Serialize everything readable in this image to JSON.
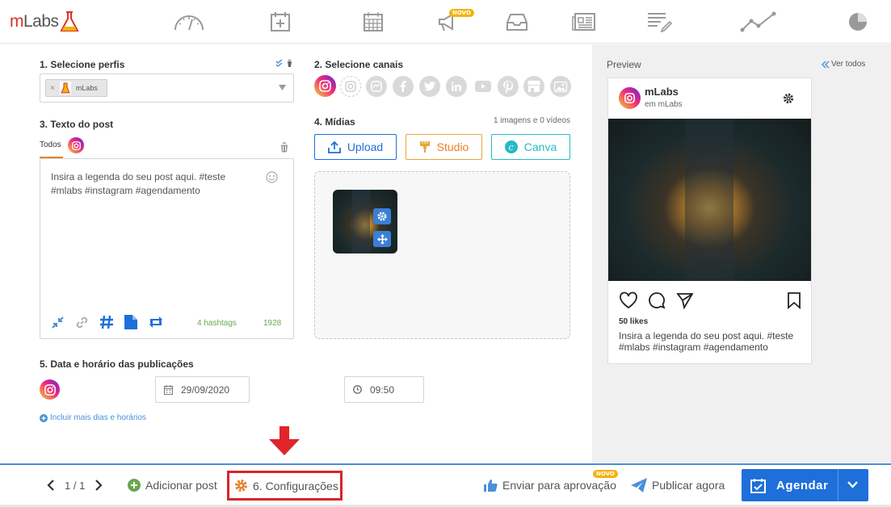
{
  "brand": {
    "logo_m": "m",
    "logo_labs": "Labs"
  },
  "topnav": {
    "novo_badge": "NOVO"
  },
  "profiles": {
    "label": "1. Selecione perfis",
    "selected": "mLabs"
  },
  "channels": {
    "label": "2. Selecione canais"
  },
  "post_text": {
    "label": "3. Texto do post",
    "tab_all": "Todos",
    "content": "Insira a legenda do seu post aqui. #teste #mlabs #instagram #agendamento",
    "hashtags": "4 hashtags",
    "chars": "1928"
  },
  "media": {
    "label": "4. Mídias",
    "count": "1 imagens e 0 vídeos",
    "upload": "Upload",
    "studio": "Studio",
    "canva": "Canva"
  },
  "schedule": {
    "label": "5. Data e horário das publicações",
    "date": "29/09/2020",
    "time": "09:50",
    "more": "Incluir mais dias e horários"
  },
  "preview": {
    "title": "Preview",
    "see_all": "Ver todos",
    "account": "mLabs",
    "sub": "em mLabs",
    "likes": "50 likes",
    "caption": "Insira a legenda do seu post aqui. #teste #mlabs #instagram #agendamento"
  },
  "bottom": {
    "pager": "1 / 1",
    "add_post": "Adicionar post",
    "settings": "6. Configurações",
    "approval": "Enviar para aprovação",
    "approval_badge": "NOVO",
    "publish_now": "Publicar agora",
    "schedule": "Agendar"
  },
  "colors": {
    "accent": "#1e6fd9",
    "highlight": "#d8232a",
    "green": "#6aa84f",
    "orange": "#e8822a"
  }
}
